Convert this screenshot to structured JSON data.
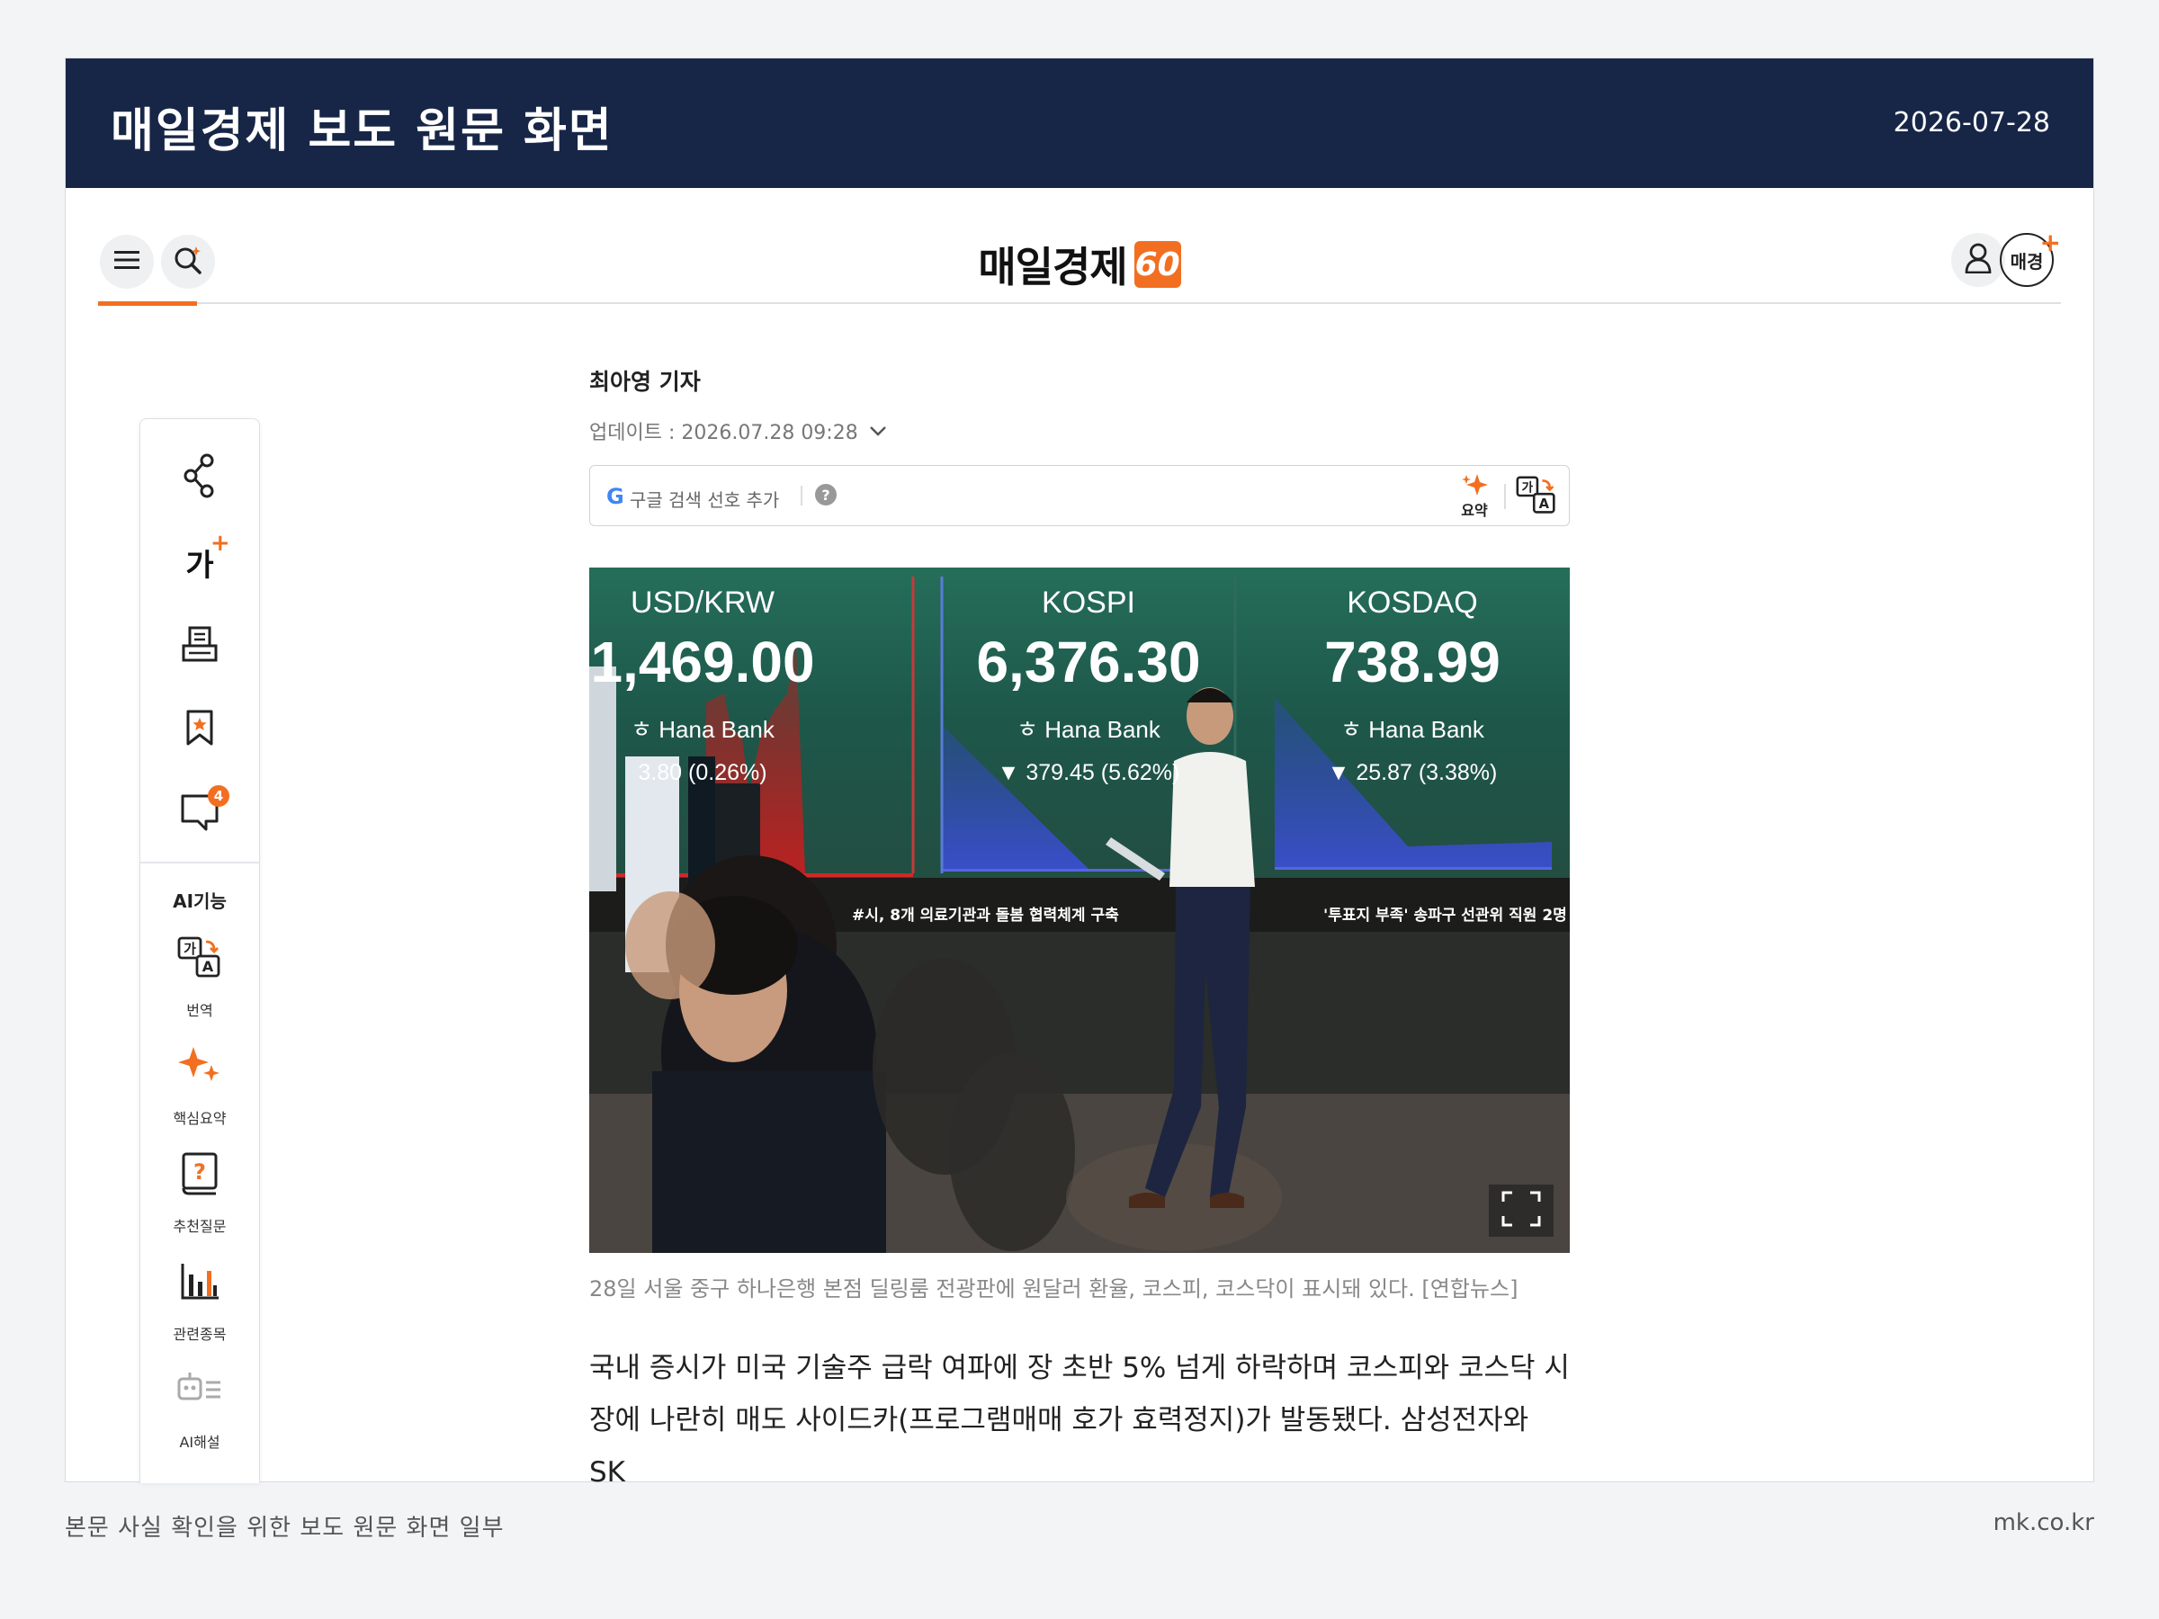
{
  "banner": {
    "title": "매일경제 보도 원문 화면",
    "date": "2026-07-28"
  },
  "header": {
    "logo_text": "매일경제",
    "logo_badge": "60",
    "menu_icon": "hamburger-icon",
    "search_icon": "ai-search-icon",
    "user_icon": "user-icon",
    "mk_plus_label": "매경",
    "mk_plus_mark": "+"
  },
  "sidebar": {
    "tools": [
      {
        "icon": "share-icon"
      },
      {
        "icon": "font-size-icon",
        "glyph": "가"
      },
      {
        "icon": "print-icon"
      },
      {
        "icon": "bookmark-icon"
      },
      {
        "icon": "comment-icon",
        "badge": "4"
      }
    ],
    "ai_title": "AI기능",
    "ai_items": [
      {
        "icon": "translate-icon",
        "label": "번역"
      },
      {
        "icon": "sparkle-icon",
        "label": "핵심요약"
      },
      {
        "icon": "question-book-icon",
        "label": "추천질문"
      },
      {
        "icon": "bar-chart-icon",
        "label": "관련종목"
      },
      {
        "icon": "robot-icon",
        "label": "AI해설"
      }
    ]
  },
  "article": {
    "reporter": "최아영 기자",
    "updated": "업데이트 : 2026.07.28 09:28",
    "toolbar": {
      "google_letter": "G",
      "google_pref": "구글 검색 선호 추가",
      "help": "?",
      "summary_label": "요약"
    },
    "photo": {
      "panels": [
        {
          "label": "USD/KRW",
          "value": "1,469.00",
          "bank": "Hana Bank",
          "change": "3.80 (0.26%)"
        },
        {
          "label": "KOSPI",
          "value": "6,376.30",
          "bank": "Hana Bank",
          "change": "▼ 379.45 (5.62%)"
        },
        {
          "label": "KOSDAQ",
          "value": "738.99",
          "bank": "Hana Bank",
          "change": "▼ 25.87 (3.38%)"
        }
      ],
      "ticker_left": "#시, 8개 의료기관과 돌봄 협력체계 구축",
      "ticker_right": "'투표지 부족' 송파구 선관위 직원 2명 ",
      "fullscreen_icon": "fullscreen-icon"
    },
    "caption": "28일 서울 중구 하나은행 본점 딜링룸 전광판에 원달러 환율, 코스피, 코스닥이 표시돼 있다. [연합뉴스]",
    "body": "국내 증시가 미국 기술주 급락 여파에 장 초반 5% 넘게 하락하며 코스피와 코스닥 시장에 나란히 매도 사이드카(프로그램매매 호가 효력정지)가 발동됐다. 삼성전자와 SK"
  },
  "footer": {
    "left": "본문 사실 확인을 위한 보도 원문 화면 일부",
    "right": "mk.co.kr"
  },
  "colors": {
    "banner_bg": "#172647",
    "accent": "#f26f21",
    "text": "#222222"
  }
}
